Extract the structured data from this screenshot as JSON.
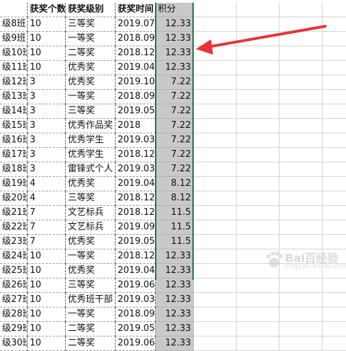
{
  "headers": [
    "",
    "获奖个数",
    "获奖级别",
    "获奖时间",
    "积分"
  ],
  "rows": [
    [
      "级8班",
      "10",
      "三等奖",
      "2019.07",
      "12.33"
    ],
    [
      "级9班",
      "10",
      "一等奖",
      "2018.09",
      "12.33"
    ],
    [
      "级10班",
      "10",
      "二等奖",
      "2018.12",
      "12.33"
    ],
    [
      "级11班",
      "10",
      "优秀奖",
      "2019.04",
      "12.33"
    ],
    [
      "级12班",
      "3",
      "优秀奖",
      "2019.10",
      "7.22"
    ],
    [
      "级13班",
      "3",
      "一等奖",
      "2018.09",
      "7.22"
    ],
    [
      "级14班",
      "3",
      "三等奖",
      "2019.05",
      "7.22"
    ],
    [
      "级15班",
      "3",
      "优秀作品奖",
      "2018",
      "7.22"
    ],
    [
      "级16班",
      "3",
      "优秀学生",
      "2019.03",
      "7.22"
    ],
    [
      "级17班",
      "3",
      "优秀学生",
      "2018.12",
      "7.22"
    ],
    [
      "级18班",
      "3",
      "雷锋式个人",
      "2019.03",
      "7.22"
    ],
    [
      "级19班",
      "4",
      "优秀奖",
      "2019.04",
      "8.12"
    ],
    [
      "级20班",
      "4",
      "三等奖",
      "2018.12",
      "8.12"
    ],
    [
      "级21班",
      "7",
      "文艺标兵",
      "2018.12",
      "11.5"
    ],
    [
      "级22班",
      "7",
      "文艺标兵",
      "2019.09",
      "11.5"
    ],
    [
      "级23班",
      "7",
      "优秀奖",
      "2019.05",
      "11.5"
    ],
    [
      "级24班",
      "10",
      "一等奖",
      "2018.12",
      "12.33"
    ],
    [
      "级25班",
      "10",
      "优秀奖",
      "2019.04",
      "12.33"
    ],
    [
      "级26班",
      "10",
      "三等奖",
      "2019.06",
      "12.33"
    ],
    [
      "级27班",
      "10",
      "优秀班干部",
      "2019.03",
      "12.33"
    ],
    [
      "级28班",
      "10",
      "一等奖",
      "2018.09",
      "12.33"
    ],
    [
      "级29班",
      "10",
      "二等奖",
      "2019.05",
      "12.33"
    ],
    [
      "级30班",
      "10",
      "二等奖",
      "2019.06",
      "12.33"
    ]
  ],
  "watermark": {
    "brand": "Bai百经验",
    "url": "jingyan.baidu.com"
  },
  "colors": {
    "selection_fill": "#c9c9c9",
    "selection_border": "#217346",
    "arrow": "#e8333a"
  },
  "icons": {
    "annotation": "red-arrow-icon",
    "watermark": "paw-logo-icon"
  }
}
